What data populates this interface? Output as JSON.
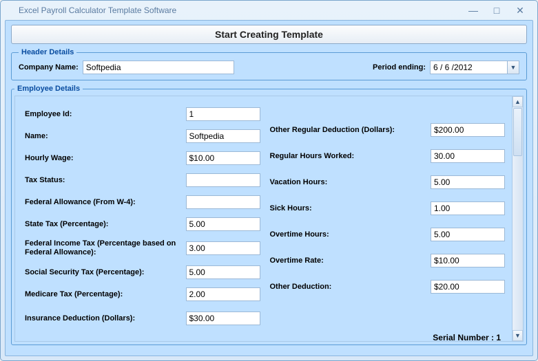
{
  "window": {
    "title": "Excel Payroll Calculator Template Software",
    "minimize": "—",
    "maximize": "□",
    "close": "✕"
  },
  "start_button": "Start Creating Template",
  "header": {
    "legend": "Header Details",
    "company_label": "Company Name:",
    "company_value": "Softpedia",
    "period_label": "Period ending:",
    "period_value": "6 / 6 /2012"
  },
  "employee": {
    "legend": "Employee Details",
    "left": {
      "employee_id": {
        "label": "Employee Id:",
        "value": "1"
      },
      "name": {
        "label": "Name:",
        "value": "Softpedia"
      },
      "hourly_wage": {
        "label": "Hourly Wage:",
        "value": "$10.00"
      },
      "tax_status": {
        "label": "Tax Status:",
        "value": ""
      },
      "federal_allowance": {
        "label": "Federal Allowance (From W-4):",
        "value": ""
      },
      "state_tax": {
        "label": "State Tax (Percentage):",
        "value": "5.00"
      },
      "federal_income_tax": {
        "label": "Federal Income Tax (Percentage based on Federal Allowance):",
        "value": "3.00"
      },
      "social_security_tax": {
        "label": "Social Security Tax (Percentage):",
        "value": "5.00"
      },
      "medicare_tax": {
        "label": "Medicare Tax (Percentage):",
        "value": "2.00"
      },
      "insurance_deduction": {
        "label": "Insurance Deduction (Dollars):",
        "value": "$30.00"
      }
    },
    "right": {
      "other_regular_deduction": {
        "label": "Other Regular Deduction (Dollars):",
        "value": "$200.00"
      },
      "regular_hours": {
        "label": "Regular Hours Worked:",
        "value": "30.00"
      },
      "vacation_hours": {
        "label": "Vacation Hours:",
        "value": "5.00"
      },
      "sick_hours": {
        "label": "Sick Hours:",
        "value": "1.00"
      },
      "overtime_hours": {
        "label": "Overtime Hours:",
        "value": "5.00"
      },
      "overtime_rate": {
        "label": "Overtime Rate:",
        "value": "$10.00"
      },
      "other_deduction": {
        "label": "Other Deduction:",
        "value": "$20.00"
      }
    },
    "serial": "Serial Number : 1"
  }
}
